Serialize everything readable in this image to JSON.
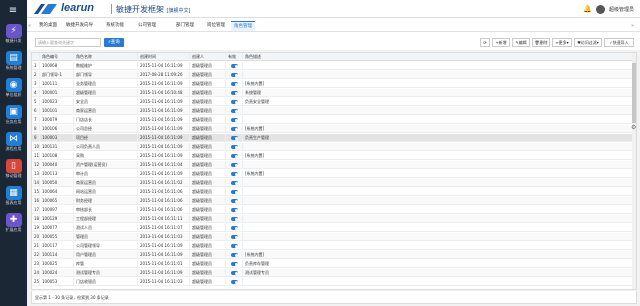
{
  "header": {
    "brand": "learun",
    "subtitle": "敏捷开发框架",
    "edition": "[旗舰中文]",
    "user": "超级管理员"
  },
  "sidebar": {
    "toggle_glyph": "≡",
    "items": [
      {
        "label": "敏捷开发",
        "icon": "lightning-icon",
        "glyph": "⚡",
        "color": "#6a55c9"
      },
      {
        "label": "系统管理",
        "icon": "monitor-icon",
        "glyph": "▤",
        "color": "#1f7fd6"
      },
      {
        "label": "单位组织",
        "icon": "org-icon",
        "glyph": "◉",
        "color": "#1f7fd6"
      },
      {
        "label": "业务应用",
        "icon": "briefcase-icon",
        "glyph": "▣",
        "color": "#1f7fd6"
      },
      {
        "label": "流程应用",
        "icon": "share-icon",
        "glyph": "⋈",
        "color": "#1f7fd6"
      },
      {
        "label": "移动管理",
        "icon": "mobile-icon",
        "glyph": "▯",
        "color": "#d9463b"
      },
      {
        "label": "报表应用",
        "icon": "chart-icon",
        "glyph": "▦",
        "color": "#1f7fd6"
      },
      {
        "label": "扩展应用",
        "icon": "extension-icon",
        "glyph": "✚",
        "color": "#6a55c9"
      }
    ]
  },
  "tabs": [
    {
      "label": "我的桌面"
    },
    {
      "label": "敏捷开发向导"
    },
    {
      "label": "系统功能"
    },
    {
      "label": "公司管理"
    },
    {
      "label": "部门管理"
    },
    {
      "label": "岗位管理"
    },
    {
      "label": "角色管理",
      "active": true
    }
  ],
  "toolbar": {
    "search_placeholder": "请输入要查询关键字",
    "query_label": "查询",
    "buttons": [
      "⟳",
      "+新增",
      "✎编辑",
      "🗑删除",
      "≡更多▾",
      "♥访问过滤▾",
      "✓快速导入"
    ]
  },
  "grid": {
    "columns": [
      "",
      "角色编号",
      "角色名称",
      "创建时间",
      "创建人",
      "有效",
      "角色描述"
    ],
    "rows": [
      [
        "1",
        "100068",
        "数据维护",
        "2015-11-04 16:11:09",
        "超级管理员",
        "on",
        ""
      ],
      [
        "2",
        "部门领导-1",
        "部门领导",
        "2017-08-28 11:09:26",
        "超级管理员",
        "on",
        ""
      ],
      [
        "3",
        "100111",
        "业务管理员",
        "2015-11-04 16:11:09",
        "超级管理员",
        "on",
        "[系统内置]"
      ],
      [
        "4",
        "100001",
        "超级管理员",
        "2015-11-04 16:10:48",
        "超级管理员",
        "on",
        "系统管理"
      ],
      [
        "5",
        "100023",
        "安全员",
        "2015-11-04 16:11:09",
        "超级管理员",
        "on",
        "负责安全管理"
      ],
      [
        "6",
        "100101",
        "商家运营员",
        "2015-11-04 16:11:09",
        "超级管理员",
        "on",
        ""
      ],
      [
        "7",
        "100079",
        "门店店长",
        "2015-11-04 16:11:09",
        "超级管理员",
        "on",
        ""
      ],
      [
        "8",
        "100106",
        "公司总经",
        "2015-11-04 16:11:09",
        "超级管理员",
        "on",
        "[系统内置]"
      ],
      [
        "9",
        "100003",
        "项目经",
        "2015-11-04 16:11:09",
        "超级管理员",
        "on",
        "负责生产管理"
      ],
      [
        "10",
        "100131",
        "公司负责人员",
        "2015-11-04 16:11:09",
        "超级管理员",
        "on",
        ""
      ],
      [
        "11",
        "100108",
        "采购",
        "2015-11-04 16:11:09",
        "超级管理员",
        "on",
        "[系统内置]"
      ],
      [
        "12",
        "100040",
        "资产管理(运营员)",
        "2015-11-04 16:11:04",
        "超级管理员",
        "on",
        ""
      ],
      [
        "13",
        "100113",
        "审计员",
        "2015-11-04 16:11:09",
        "超级管理员",
        "on",
        "[系统内置]"
      ],
      [
        "14",
        "100050",
        "商家运营员",
        "2015-11-04 16:11:02",
        "超级管理员",
        "on",
        ""
      ],
      [
        "15",
        "100064",
        "网站运营员",
        "2015-11-04 16:11:06",
        "超级管理员",
        "on",
        ""
      ],
      [
        "16",
        "100065",
        "财务经理",
        "2015-11-04 16:11:06",
        "超级管理员",
        "on",
        ""
      ],
      [
        "17",
        "100097",
        "审核部长",
        "2015-11-04 16:11:06",
        "超级管理员",
        "on",
        ""
      ],
      [
        "18",
        "100129",
        "工程部经理",
        "2015-11-04 16:11:11",
        "超级管理员",
        "on",
        ""
      ],
      [
        "19",
        "100077",
        "测试人员",
        "2015-11-04 16:11:07",
        "超级管理员",
        "on",
        ""
      ],
      [
        "20",
        "100055",
        "管理员",
        "2013-11-04 16:11:03",
        "超级管理员",
        "on",
        ""
      ],
      [
        "21",
        "100117",
        "公司管理领导",
        "2015-11-04 16:11:09",
        "超级管理员",
        "on",
        ""
      ],
      [
        "22",
        "100114",
        "用户管理员",
        "2015-11-04 16:11:09",
        "超级管理员",
        "on",
        "[系统内置]"
      ],
      [
        "23",
        "100025",
        "库管",
        "2015-11-04 16:11:01",
        "超级管理员",
        "on",
        "负责库存管理"
      ],
      [
        "24",
        "100024",
        "测试管理专员",
        "2015-11-04 16:11:09",
        "超级管理员",
        "on",
        "测试管理专员"
      ],
      [
        "25",
        "100053",
        "门店收银员",
        "2015-11-04 16:11:03",
        "超级管理员",
        "on",
        ""
      ]
    ],
    "highlighted_row": 8
  },
  "footer": {
    "summary": "显示第 1 - 30 条记录，检索到 30 条记录"
  }
}
